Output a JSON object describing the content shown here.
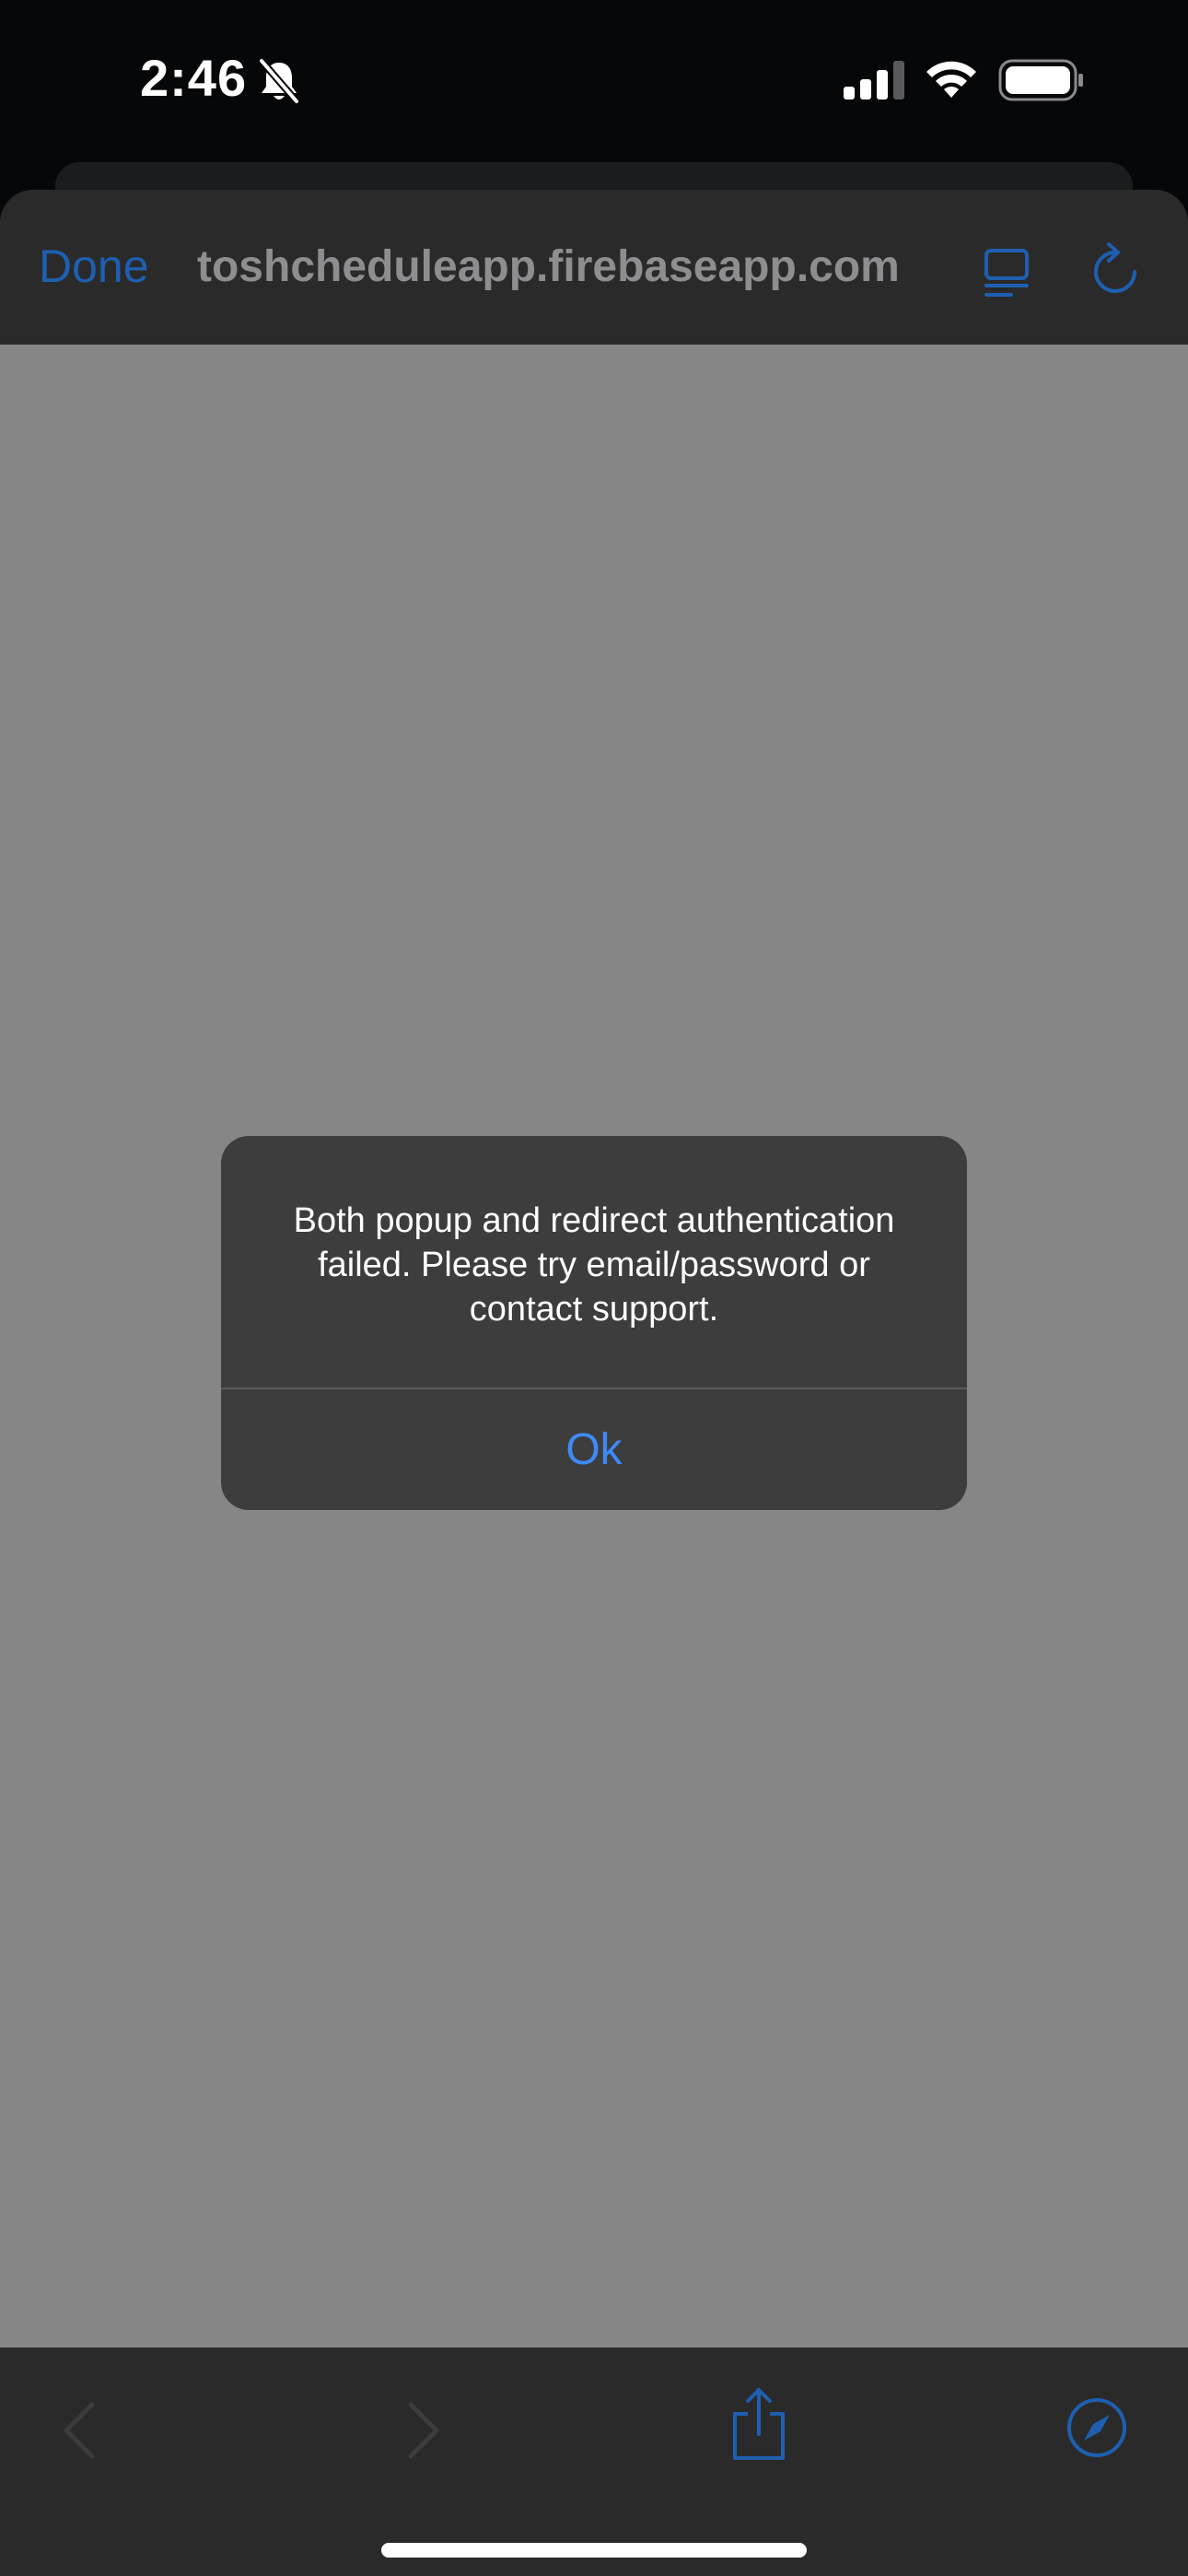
{
  "status_bar": {
    "time": "2:46",
    "icons": [
      "bell-slash-icon",
      "cellular-signal-icon",
      "wifi-icon",
      "battery-icon"
    ]
  },
  "browser": {
    "done_label": "Done",
    "url": "toshcheduleapp.firebaseapp.com",
    "top_icons": [
      "reader-mode-icon",
      "reload-icon"
    ],
    "bottom_icons": [
      "back-chevron-icon",
      "forward-chevron-icon",
      "share-icon",
      "compass-icon"
    ]
  },
  "alert": {
    "message": "Both popup and redirect authentication failed. Please try email/password or contact support.",
    "ok_label": "Ok"
  },
  "colors": {
    "accent": "#3e8bf7",
    "dim_accent": "#1e5fb0",
    "sheet_bg": "#2a2a2b",
    "content_dim": "#868686",
    "alert_bg": "#3d3d3e"
  }
}
